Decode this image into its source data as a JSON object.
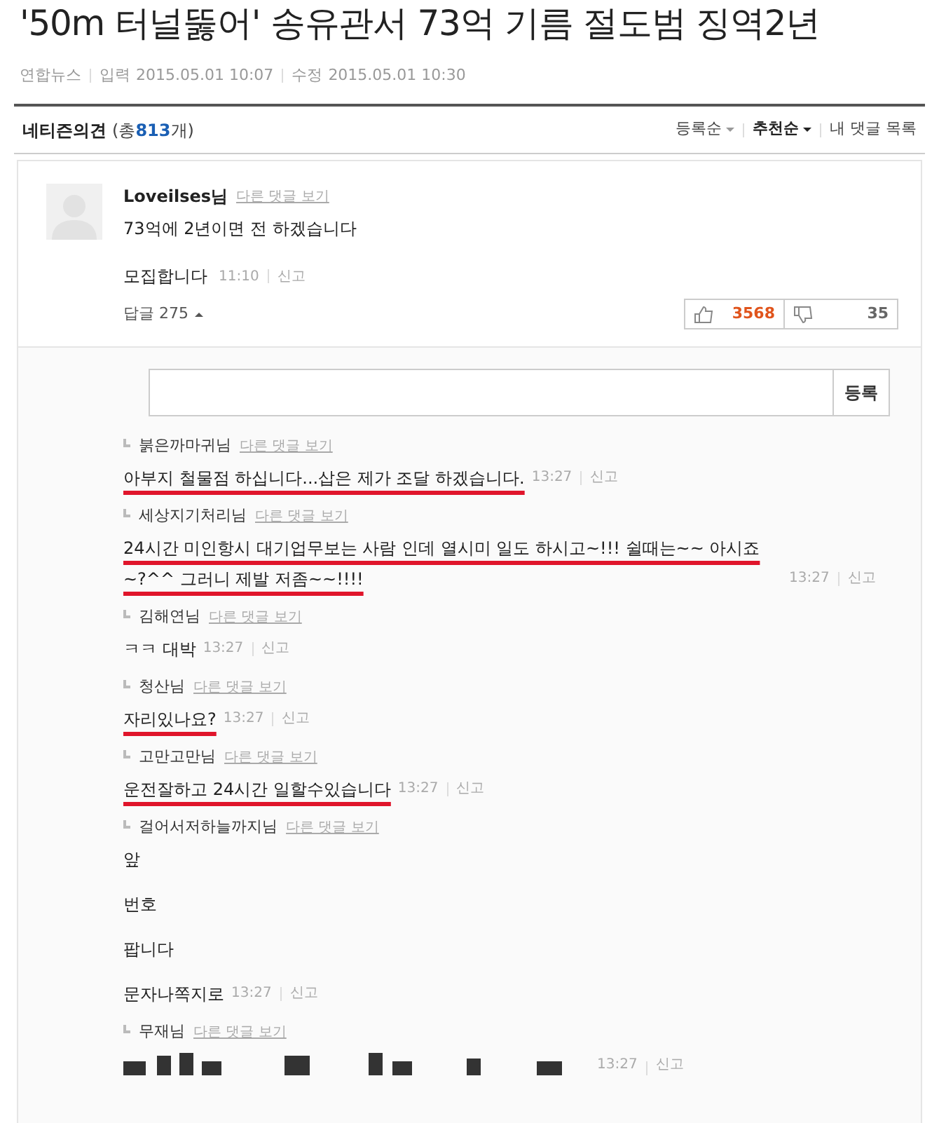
{
  "article": {
    "title": "'50m 터널뚫어' 송유관서 73억 기름 절도범 징역2년",
    "source": "연합뉴스",
    "input_label": "입력",
    "input_time": "2015.05.01 10:07",
    "edit_label": "수정",
    "edit_time": "2015.05.01 10:30"
  },
  "comments_header": {
    "title": "네티즌의견",
    "count_prefix": "(총",
    "count": "813",
    "count_suffix": "개)",
    "sort_options": [
      {
        "label": "등록순",
        "selected": false
      },
      {
        "label": "추천순",
        "selected": true
      }
    ],
    "my_comments": "내 댓글 목록"
  },
  "comment": {
    "author": "Loveilses님",
    "other_link": "다른 댓글 보기",
    "lines": [
      "73억에 2년이면 전 하겠습니다",
      "모집합니다"
    ],
    "time": "11:10",
    "report": "신고",
    "replies_label": "답글 275",
    "expanded": true,
    "up_votes": "3568",
    "down_votes": "35"
  },
  "reply_form": {
    "button": "등록"
  },
  "replies": [
    {
      "kind": "text",
      "author": "붉은까마귀님",
      "other_link": "다른 댓글 보기",
      "lines": [
        "아부지 철물점 하십니다...삽은 제가 조달 하겠습니다."
      ],
      "time": "13:27",
      "report": "신고",
      "underlined": true
    },
    {
      "kind": "text",
      "author": "세상지기처리님",
      "other_link": "다른 댓글 보기",
      "lines": [
        "24시간 미인항시 대기업무보는 사람 인데 열시미 일도 하시고~!!! 쉴때는~~ 아시죠~?^^ 그러니 제발 저좀~~!!!!"
      ],
      "time": "13:27",
      "report": "신고",
      "underlined": true
    },
    {
      "kind": "text",
      "author": "김해연님",
      "other_link": "다른 댓글 보기",
      "lines": [
        "ㅋㅋ 대박"
      ],
      "time": "13:27",
      "report": "신고",
      "underlined": false
    },
    {
      "kind": "text",
      "author": "청산님",
      "other_link": "다른 댓글 보기",
      "lines": [
        "자리있나요?"
      ],
      "time": "13:27",
      "report": "신고",
      "underlined": true
    },
    {
      "kind": "text",
      "author": "고만고만님",
      "other_link": "다른 댓글 보기",
      "lines": [
        "운전잘하고 24시간 일할수있습니다"
      ],
      "time": "13:27",
      "report": "신고",
      "underlined": true
    },
    {
      "kind": "text",
      "author": "걸어서저하늘까지님",
      "other_link": "다른 댓글 보기",
      "lines": [
        "앞",
        "번호",
        "팝니다",
        "문자나쪽지로"
      ],
      "time": "13:27",
      "report": "신고",
      "underlined": false
    },
    {
      "kind": "oversized",
      "author": "무재님",
      "other_link": "다른 댓글 보기",
      "time": "13:27",
      "report": "신고",
      "underlined": false
    }
  ]
}
